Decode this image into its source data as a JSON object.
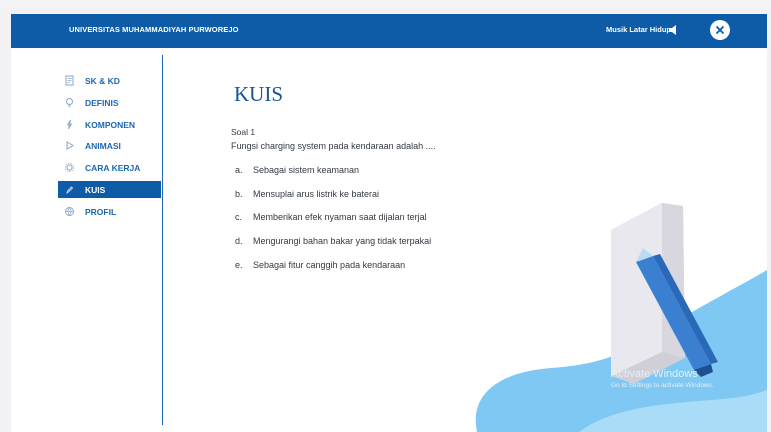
{
  "header": {
    "brand": "UNIVERSITAS MUHAMMADIYAH PURWOREJO",
    "music_label": "Musik Latar Hidup",
    "speaker_icon": "speaker-icon",
    "close_icon": "close-icon"
  },
  "sidebar": {
    "items": [
      {
        "label": "SK & KD",
        "icon": "document-icon",
        "active": false
      },
      {
        "label": "DEFINIS",
        "icon": "bulb-icon",
        "active": false
      },
      {
        "label": "KOMPONEN",
        "icon": "puzzle-icon",
        "active": false
      },
      {
        "label": "ANIMASI",
        "icon": "play-icon",
        "active": false
      },
      {
        "label": "CARA KERJA",
        "icon": "gear-icon",
        "active": false
      },
      {
        "label": "KUIS",
        "icon": "pencil-icon",
        "active": true
      },
      {
        "label": "PROFIL",
        "icon": "globe-icon",
        "active": false
      }
    ]
  },
  "quiz": {
    "title": "KUIS",
    "soal_label": "Soal 1",
    "question": "Fungsi charging system pada kendaraan adalah ....",
    "options": [
      {
        "letter": "a.",
        "text": "Sebagai sistem keamanan"
      },
      {
        "letter": "b.",
        "text": "Mensuplai arus listrik ke baterai"
      },
      {
        "letter": "c.",
        "text": "Memberikan efek nyaman saat dijalan terjal"
      },
      {
        "letter": "d.",
        "text": "Mengurangi bahan bakar yang tidak terpakai"
      },
      {
        "letter": "e.",
        "text": "Sebagai fitur canggih pada kendaraan"
      }
    ]
  },
  "watermark": {
    "line1": "Activate Windows",
    "line2": "Go to Settings to activate Windows."
  },
  "colors": {
    "brand_blue": "#0e5ba8",
    "title_blue": "#17529b",
    "light_blue": "#7ec8f3",
    "pencil_blue": "#3a7fd0"
  }
}
